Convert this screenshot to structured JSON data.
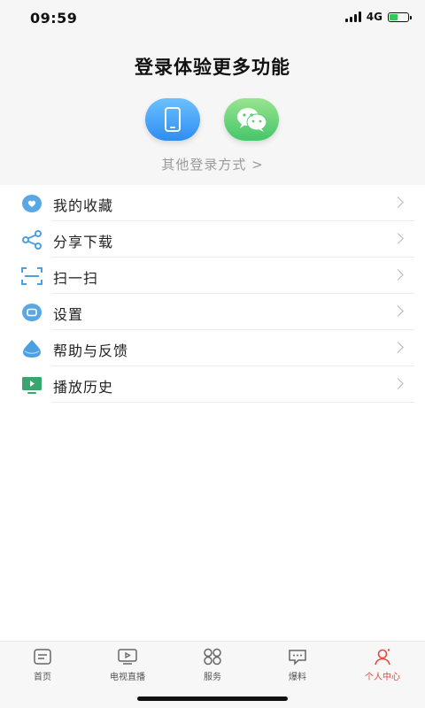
{
  "status_bar": {
    "time": "09:59",
    "network": "4G"
  },
  "login": {
    "title": "登录体验更多功能",
    "phone_icon": "phone-icon",
    "wechat_icon": "wechat-icon",
    "other_methods": "其他登录方式 >"
  },
  "menu": {
    "items": [
      {
        "label": "我的收藏",
        "icon": "heart-icon"
      },
      {
        "label": "分享下载",
        "icon": "share-icon"
      },
      {
        "label": "扫一扫",
        "icon": "scan-icon"
      },
      {
        "label": "设置",
        "icon": "settings-icon"
      },
      {
        "label": "帮助与反馈",
        "icon": "help-feedback-icon"
      },
      {
        "label": "播放历史",
        "icon": "play-history-icon"
      }
    ]
  },
  "tabbar": {
    "tabs": [
      {
        "label": "首页",
        "icon": "home-icon"
      },
      {
        "label": "电视直播",
        "icon": "tv-icon"
      },
      {
        "label": "服务",
        "icon": "services-icon"
      },
      {
        "label": "爆料",
        "icon": "chat-icon"
      },
      {
        "label": "个人中心",
        "icon": "user-icon"
      }
    ],
    "active_color": "#e14b3b"
  },
  "colors": {
    "accent_blue": "#2f8df2",
    "accent_green": "#45c66a",
    "active_tab": "#e14b3b"
  }
}
